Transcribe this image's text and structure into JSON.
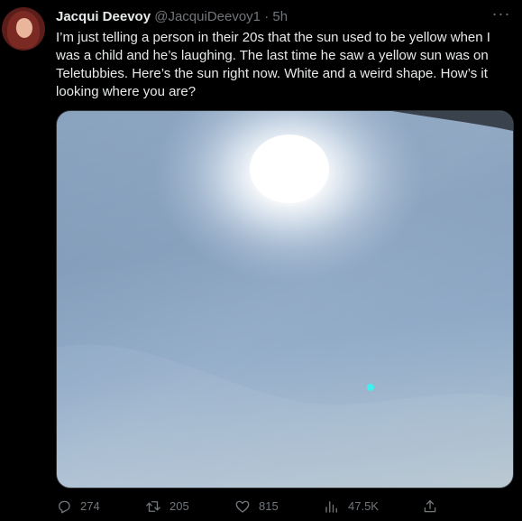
{
  "tweet": {
    "author_name": "Jacqui Deevoy",
    "handle": "@JacquiDeevoy1",
    "separator": "·",
    "time": "5h",
    "text": "I’m just telling a person in their 20s that the sun used to be yellow when I was a child and he’s laughing. The last time he saw a yellow sun was on Teletubbies. Here’s the sun right now. White and a weird shape. How’s it looking where you are?",
    "more_label": "···"
  },
  "actions": {
    "reply": {
      "icon": "reply-icon",
      "count": "274"
    },
    "retweet": {
      "icon": "retweet-icon",
      "count": "205"
    },
    "like": {
      "icon": "heart-icon",
      "count": "815"
    },
    "views": {
      "icon": "views-icon",
      "count": "47.5K"
    },
    "share": {
      "icon": "share-icon"
    }
  },
  "colors": {
    "background": "#000000",
    "text": "#e7e9ea",
    "muted": "#71767b",
    "border": "#2f3336"
  }
}
